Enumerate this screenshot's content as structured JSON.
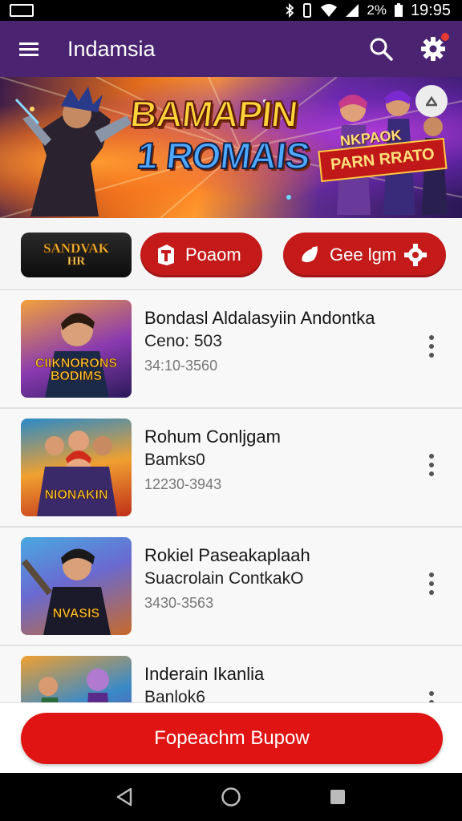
{
  "status_bar": {
    "battery_percent": "2%",
    "time": "19:95"
  },
  "app_bar": {
    "title": "Indamsia",
    "icons": [
      "menu-icon",
      "search-icon",
      "gear-icon"
    ]
  },
  "banner": {
    "headline_line1": "BAMAPIN",
    "headline_line2": "1 ROMAIS",
    "tag_top": "NKPAOK",
    "tag_main": "PARN RRATO"
  },
  "filters": {
    "logo_text_line1": "SANDVAK",
    "logo_text_line2": "HR",
    "pill1_label": "Poaom",
    "pill2_label": "Gee lgm"
  },
  "list": {
    "items": [
      {
        "title": "Bondasl Aldalasyiin Andontka",
        "subtitle": "Ceno: 503",
        "meta": "34:10-3560",
        "thumb_caption": "CIIKNORONS BODIMS"
      },
      {
        "title": "Rohum Conljgam",
        "subtitle": "Bamks0",
        "meta": "12230-3943",
        "thumb_caption": "NIONAKIN"
      },
      {
        "title": "Rokiel Paseakaplaah",
        "subtitle": "Suacrolain ContkakO",
        "meta": "3430-3563",
        "thumb_caption": "NVASIS"
      },
      {
        "title": "Inderain Ikanlia",
        "subtitle": "Banlok6",
        "meta": "",
        "thumb_caption": ""
      }
    ]
  },
  "cta": {
    "label": "Fopeachm Bupow"
  },
  "colors": {
    "app_bar": "#4a2470",
    "accent_red": "#e11414",
    "pill_red": "#c41a1a"
  }
}
